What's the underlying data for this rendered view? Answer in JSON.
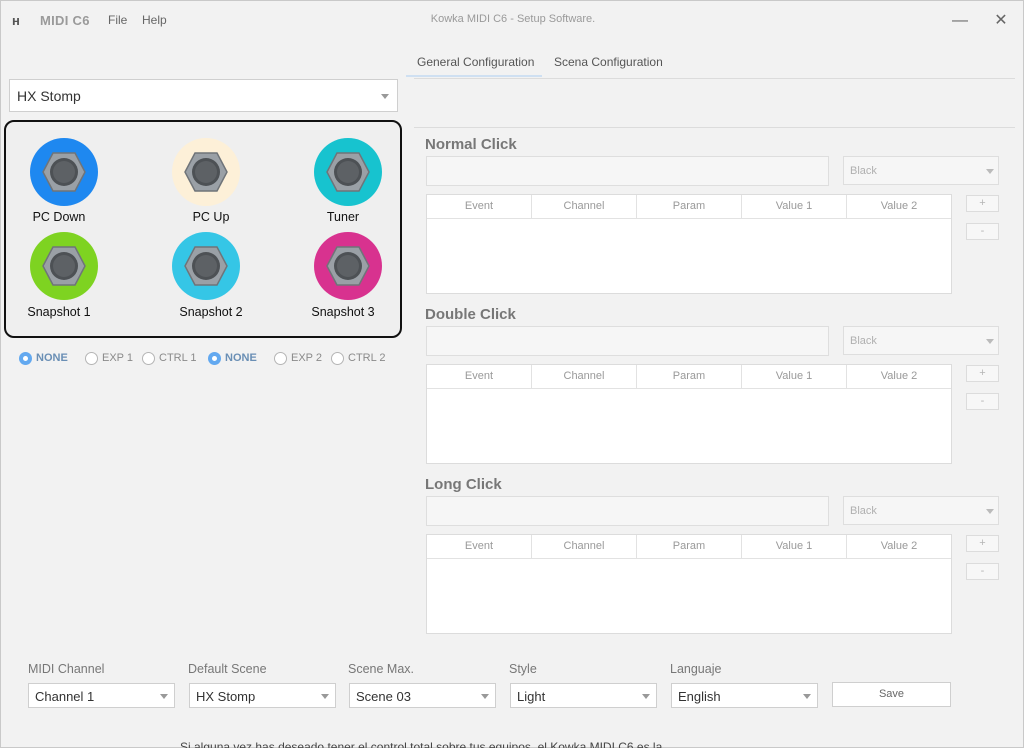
{
  "app": {
    "logo_text": "ʜ",
    "name": "MIDI C6",
    "window_title": "Kowka MIDI C6 - Setup Software.",
    "menu": [
      "File",
      "Help"
    ],
    "minimize": "—",
    "close": "✕"
  },
  "tabs": [
    {
      "label": "General Configuration",
      "active": true
    },
    {
      "label": "Scena Configuration",
      "active": false
    }
  ],
  "device_select": {
    "value": "HX Stomp"
  },
  "footswitches": [
    {
      "label": "PC Down",
      "color": "#1e88f0"
    },
    {
      "label": "PC Up",
      "color": "#fdf0d8"
    },
    {
      "label": "Tuner",
      "color": "#17c3cf"
    },
    {
      "label": "Snapshot 1",
      "color": "#7ed321"
    },
    {
      "label": "Snapshot 2",
      "color": "#35c6e6"
    },
    {
      "label": "Snapshot 3",
      "color": "#d8328f"
    }
  ],
  "expression_left": [
    {
      "label": "NONE",
      "selected": true
    },
    {
      "label": "EXP 1",
      "selected": false
    },
    {
      "label": "CTRL 1",
      "selected": false
    }
  ],
  "expression_right": [
    {
      "label": "NONE",
      "selected": true
    },
    {
      "label": "EXP 2",
      "selected": false
    },
    {
      "label": "CTRL 2",
      "selected": false
    }
  ],
  "event_columns": [
    "Event",
    "Channel",
    "Param",
    "Value 1",
    "Value 2"
  ],
  "sections": [
    {
      "title": "Normal Click",
      "color_value": "Black"
    },
    {
      "title": "Double Click",
      "color_value": "Black"
    },
    {
      "title": "Long Click",
      "color_value": "Black"
    }
  ],
  "mini_buttons": {
    "add": "+",
    "remove": "-"
  },
  "bottom": {
    "midi_channel": {
      "label": "MIDI Channel",
      "value": "Channel 1"
    },
    "default_scene": {
      "label": "Default Scene",
      "value": "HX Stomp"
    },
    "scene_max": {
      "label": "Scene Max.",
      "value": "Scene 03"
    },
    "style": {
      "label": "Style",
      "value": "Light"
    },
    "language": {
      "label": "Languaje",
      "value": "English"
    },
    "save_label": "Save"
  },
  "bleed_text": "Si alguna vez has deseado tener el control total sobre tus equipos, el Kowka MIDI C6 es la"
}
